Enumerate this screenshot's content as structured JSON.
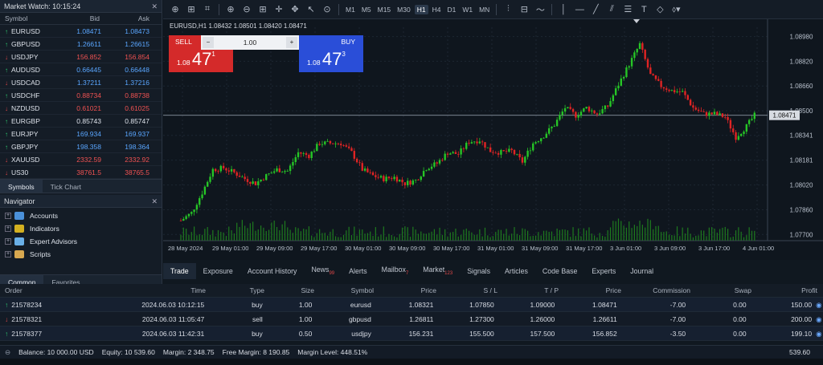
{
  "market_watch": {
    "title": "Market Watch: 10:15:24",
    "close": "✕",
    "headers": [
      "Symbol",
      "Bid",
      "Ask"
    ],
    "rows": [
      {
        "sym": "EURUSD",
        "dir": "up",
        "bid": "1.08471",
        "ask": "1.08473",
        "color": "blue"
      },
      {
        "sym": "GBPUSD",
        "dir": "up",
        "bid": "1.26611",
        "ask": "1.26615",
        "color": "blue"
      },
      {
        "sym": "USDJPY",
        "dir": "dn",
        "bid": "156.852",
        "ask": "156.854",
        "color": "red"
      },
      {
        "sym": "AUDUSD",
        "dir": "up",
        "bid": "0.66445",
        "ask": "0.66448",
        "color": "blue"
      },
      {
        "sym": "USDCAD",
        "dir": "dn",
        "bid": "1.37211",
        "ask": "1.37216",
        "color": "blue"
      },
      {
        "sym": "USDCHF",
        "dir": "up",
        "bid": "0.88734",
        "ask": "0.88738",
        "color": "red"
      },
      {
        "sym": "NZDUSD",
        "dir": "dn",
        "bid": "0.61021",
        "ask": "0.61025",
        "color": "red"
      },
      {
        "sym": "EURGBP",
        "dir": "up",
        "bid": "0.85743",
        "ask": "0.85747",
        "color": "white"
      },
      {
        "sym": "EURJPY",
        "dir": "up",
        "bid": "169.934",
        "ask": "169.937",
        "color": "blue"
      },
      {
        "sym": "GBPJPY",
        "dir": "up",
        "bid": "198.358",
        "ask": "198.364",
        "color": "blue"
      },
      {
        "sym": "XAUUSD",
        "dir": "dn",
        "bid": "2332.59",
        "ask": "2332.92",
        "color": "red"
      },
      {
        "sym": "US30",
        "dir": "dn",
        "bid": "38761.5",
        "ask": "38765.5",
        "color": "red"
      }
    ],
    "tabs": [
      "Symbols",
      "Tick Chart"
    ]
  },
  "navigator": {
    "title": "Navigator",
    "close": "✕",
    "items": [
      {
        "label": "Accounts",
        "color": "#4a90d9"
      },
      {
        "label": "Indicators",
        "color": "#d4b020"
      },
      {
        "label": "Expert Advisors",
        "color": "#6ab0e8"
      },
      {
        "label": "Scripts",
        "color": "#d8a850"
      }
    ],
    "tabs": [
      "Common",
      "Favorites"
    ]
  },
  "toolbar": {
    "timeframes": [
      "M1",
      "M5",
      "M15",
      "M30",
      "H1",
      "H4",
      "D1",
      "W1",
      "MN"
    ],
    "active_timeframe": "H1"
  },
  "chart": {
    "symbol_label": "EURUSD,H1  1.08432 1.08501 1.08420 1.08471",
    "sell_label": "SELL",
    "buy_label": "BUY",
    "sell_price_prefix": "1.08",
    "sell_price_big": "47",
    "sell_price_sup": "1",
    "buy_price_prefix": "1.08",
    "buy_price_big": "47",
    "buy_price_sup": "3",
    "volume": "1.00",
    "minus": "−",
    "plus": "+",
    "current_price": "1.08471",
    "price_labels": [
      "1.08980",
      "1.08820",
      "1.08660",
      "1.08500",
      "1.08341",
      "1.08181",
      "1.08020",
      "1.07860",
      "1.07700"
    ],
    "time_labels": [
      "28 May 2024",
      "29 May 01:00",
      "29 May 09:00",
      "29 May 17:00",
      "30 May 01:00",
      "30 May 09:00",
      "30 May 17:00",
      "31 May 01:00",
      "31 May 09:00",
      "31 May 17:00",
      "3 Jun 01:00",
      "3 Jun 09:00",
      "3 Jun 17:00",
      "4 Jun 01:00"
    ],
    "bull_color": "#26c526",
    "bear_color": "#e02424"
  },
  "chart_data": {
    "type": "candlestick",
    "title": "EURUSD,H1",
    "x_range": [
      "28 May 2024",
      "4 Jun 01:00"
    ],
    "ylim": [
      1.0766,
      1.0904
    ],
    "current_price": 1.08471,
    "path_points": [
      [
        0,
        1.0779
      ],
      [
        4,
        1.0784
      ],
      [
        8,
        1.0797
      ],
      [
        12,
        1.0812
      ],
      [
        16,
        1.0813
      ],
      [
        20,
        1.081
      ],
      [
        24,
        1.0806
      ],
      [
        28,
        1.0803
      ],
      [
        32,
        1.0808
      ],
      [
        36,
        1.0812
      ],
      [
        40,
        1.0811
      ],
      [
        44,
        1.0823
      ],
      [
        48,
        1.0821
      ],
      [
        52,
        1.0829
      ],
      [
        56,
        1.0829
      ],
      [
        60,
        1.0829
      ],
      [
        64,
        1.0823
      ],
      [
        68,
        1.0812
      ],
      [
        72,
        1.0808
      ],
      [
        76,
        1.0806
      ],
      [
        80,
        1.0807
      ],
      [
        84,
        1.0803
      ],
      [
        88,
        1.0805
      ],
      [
        92,
        1.0813
      ],
      [
        96,
        1.0816
      ],
      [
        100,
        1.0823
      ],
      [
        104,
        1.0822
      ],
      [
        108,
        1.083
      ],
      [
        112,
        1.0831
      ],
      [
        116,
        1.0824
      ],
      [
        120,
        1.0823
      ],
      [
        124,
        1.0824
      ],
      [
        128,
        1.0817
      ],
      [
        132,
        1.0829
      ],
      [
        136,
        1.0834
      ],
      [
        140,
        1.0841
      ],
      [
        144,
        1.0852
      ],
      [
        148,
        1.0847
      ],
      [
        152,
        1.0852
      ],
      [
        156,
        1.0848
      ],
      [
        160,
        1.0853
      ],
      [
        164,
        1.0867
      ],
      [
        168,
        1.088
      ],
      [
        172,
        1.0893
      ],
      [
        176,
        1.0873
      ],
      [
        180,
        1.0866
      ],
      [
        184,
        1.0863
      ],
      [
        188,
        1.0862
      ],
      [
        192,
        1.0852
      ],
      [
        196,
        1.0848
      ],
      [
        200,
        1.0848
      ],
      [
        204,
        1.0846
      ],
      [
        208,
        1.0833
      ],
      [
        212,
        1.084
      ],
      [
        215,
        1.0847
      ]
    ]
  },
  "terminal": {
    "tabs": [
      {
        "label": "Trade",
        "badge": ""
      },
      {
        "label": "Exposure",
        "badge": ""
      },
      {
        "label": "Account History",
        "badge": ""
      },
      {
        "label": "News",
        "badge": "99"
      },
      {
        "label": "Alerts",
        "badge": ""
      },
      {
        "label": "Mailbox",
        "badge": "7"
      },
      {
        "label": "Market",
        "badge": "123"
      },
      {
        "label": "Signals",
        "badge": ""
      },
      {
        "label": "Articles",
        "badge": ""
      },
      {
        "label": "Code Base",
        "badge": ""
      },
      {
        "label": "Experts",
        "badge": ""
      },
      {
        "label": "Journal",
        "badge": ""
      }
    ],
    "headers": {
      "order": "Order",
      "time": "Time",
      "type": "Type",
      "size": "Size",
      "symbol": "Symbol",
      "price": "Price",
      "sl": "S / L",
      "tp": "T / P",
      "price2": "Price",
      "commission": "Commission",
      "swap": "Swap",
      "profit": "Profit"
    },
    "rows": [
      {
        "order": "21578234",
        "dir": "up",
        "time": "2024.06.03 10:12:15",
        "type": "buy",
        "size": "1.00",
        "symbol": "eurusd",
        "price": "1.08321",
        "sl": "1.07850",
        "tp": "1.09000",
        "price2": "1.08471",
        "commission": "-7.00",
        "swap": "0.00",
        "profit": "150.00"
      },
      {
        "order": "21578321",
        "dir": "dn",
        "time": "2024.06.03 11:05:47",
        "type": "sell",
        "size": "1.00",
        "symbol": "gbpusd",
        "price": "1.26811",
        "sl": "1.27300",
        "tp": "1.26000",
        "price2": "1.26611",
        "commission": "-7.00",
        "swap": "0.00",
        "profit": "200.00"
      },
      {
        "order": "21578377",
        "dir": "up",
        "time": "2024.06.03 11:42:31",
        "type": "buy",
        "size": "0.50",
        "symbol": "usdjpy",
        "price": "156.231",
        "sl": "155.500",
        "tp": "157.500",
        "price2": "156.852",
        "commission": "-3.50",
        "swap": "0.00",
        "profit": "199.10"
      }
    ],
    "balance": {
      "balance": "Balance: 10 000.00 USD",
      "equity": "Equity: 10 539.60",
      "margin": "Margin: 2 348.75",
      "free_margin": "Free Margin: 8 190.85",
      "margin_level": "Margin Level: 448.51%",
      "total_profit": "539.60"
    }
  }
}
